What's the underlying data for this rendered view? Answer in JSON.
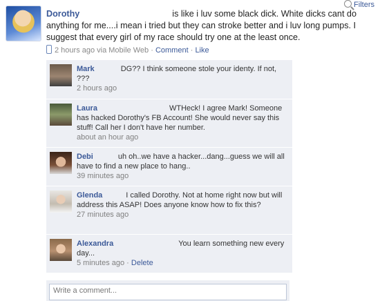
{
  "filters": {
    "label": "Filters",
    "icon": "search-icon"
  },
  "post": {
    "author": "Dorothy",
    "text": "is like i luv some black dick. White dicks cant do anything for me....i mean i tried but they can stroke better and i luv long pumps. I suggest that every girl of my race should try one at the least once.",
    "time": "2 hours ago via Mobile Web",
    "sep1": "·",
    "comment_link": "Comment",
    "sep2": "·",
    "like_link": "Like",
    "icon": "mobile-icon"
  },
  "comments": [
    {
      "name": "Mark",
      "text": "DG?? I think someone stole your identy. If not, ???",
      "time": "2 hours ago"
    },
    {
      "name": "Laura",
      "text": "WTHeck! I agree Mark! Someone has hacked Dorothy's FB Account! She would never say this stuff! Call her I don't have her number.",
      "time": "about an hour ago"
    },
    {
      "name": "Debi",
      "text": "uh oh..we have a hacker...dang...guess we will all have to find a new place to hang..",
      "time": "39 minutes ago"
    },
    {
      "name": "Glenda",
      "text": "I called Dorothy. Not at home right now but will address this ASAP! Does anyone know how to fix this?",
      "time": "27 minutes ago"
    },
    {
      "name": "Alexandra",
      "text": "You learn something new every day...",
      "time": "5 minutes ago",
      "sep": "·",
      "delete_link": "Delete"
    }
  ],
  "write_comment": {
    "placeholder": "Write a comment..."
  },
  "colors": {
    "link": "#3b5998",
    "comment_bg": "#edeff4",
    "meta": "#808080"
  }
}
